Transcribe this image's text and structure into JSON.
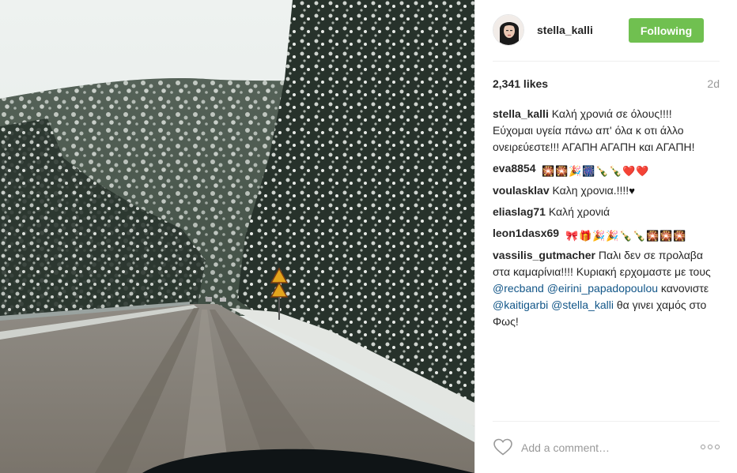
{
  "post": {
    "author": "stella_kalli",
    "follow_label": "Following",
    "likes": "2,341 likes",
    "age": "2d",
    "photo_icon": "snowy-mountain-road-photo"
  },
  "comments": [
    {
      "user": "stella_kalli",
      "text": "Καλή χρονιά σε όλους!!!! Εύχομαι υγεία πάνω απ' όλα κ οτι άλλο ονειρεύεστε!!! ΑΓΑΠΗ ΑΓΑΠΗ και ΑΓΑΠΗ!"
    },
    {
      "user": "eva8854",
      "emojis": [
        "🎇",
        "🎇",
        "🎉",
        "🎆",
        "🍾",
        "🍾",
        "❤️",
        "❤️"
      ]
    },
    {
      "user": "voulasklav",
      "text": "Καλη χρονια.!!!!"
    },
    {
      "user": "eliaslag71",
      "text": "Καλή χρονιά"
    },
    {
      "user": "leon1dasx69",
      "emojis": [
        "🎀",
        "🎁",
        "🎉",
        "🎉",
        "🍾",
        "🍾",
        "🎇",
        "🎇",
        "🎇"
      ]
    },
    {
      "user": "vassilis_gutmacher",
      "text1": "Παλι δεν σε προλαβα στα καμαρίνια!!!! Κυριακή ερχομαστε με τους",
      "mention1": "@recband",
      "mention2": "@eirini_papadopoulou",
      "text2": "κανονιστε",
      "mention3": "@kaitigarbi",
      "mention4": "@stella_kalli",
      "text3": "θα γινει χαμός στο Φως!"
    }
  ],
  "footer": {
    "comment_placeholder": "Add a comment…",
    "heart_icon": "heart-outline-icon",
    "more_icon": "more-options-icon"
  },
  "colors": {
    "follow_button": "#70c050",
    "mention": "#125688",
    "muted": "#999999"
  }
}
